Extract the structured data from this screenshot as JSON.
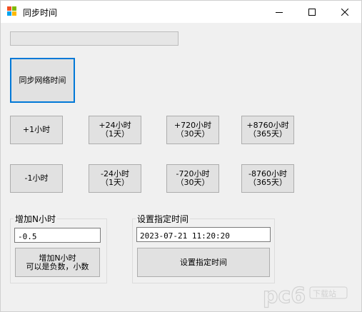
{
  "window": {
    "title": "同步时间",
    "icon": "app-window-icon",
    "controls": {
      "minimize": "minimize-icon",
      "maximize": "maximize-icon",
      "close": "close-icon"
    }
  },
  "progress": {
    "value": 0
  },
  "sync_button": {
    "label": "同步网络时间"
  },
  "add_buttons": [
    {
      "line1": "+1小时",
      "line2": ""
    },
    {
      "line1": "+24小时",
      "line2": "（1天）"
    },
    {
      "line1": "+720小时",
      "line2": "（30天）"
    },
    {
      "line1": "+8760小时",
      "line2": "（365天）"
    }
  ],
  "sub_buttons": [
    {
      "line1": "-1小时",
      "line2": ""
    },
    {
      "line1": "-24小时",
      "line2": "（1天）"
    },
    {
      "line1": "-720小时",
      "line2": "（30天）"
    },
    {
      "line1": "-8760小时",
      "line2": "（365天）"
    }
  ],
  "add_n_group": {
    "label": "增加N小时",
    "input_value": "-0.5",
    "button_line1": "增加N小时",
    "button_line2": "可以是负数，小数"
  },
  "set_time_group": {
    "label": "设置指定时间",
    "input_value": "2023-07-21 11:20:20",
    "button_label": "设置指定时间"
  },
  "watermark": {
    "text": "pc6",
    "sub": "下载站"
  }
}
